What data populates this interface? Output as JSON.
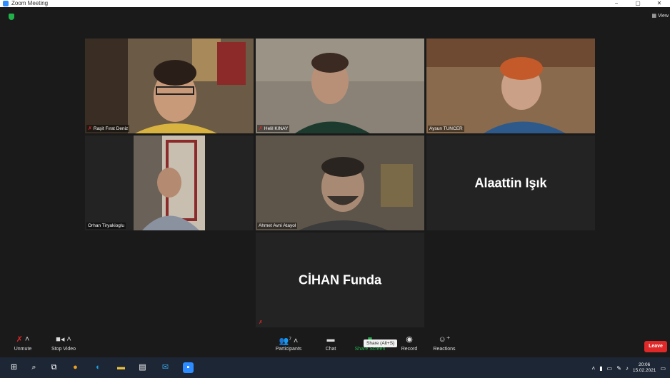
{
  "window": {
    "title": "Zoom Meeting",
    "minimize": "−",
    "maximize": "▢",
    "close": "✕"
  },
  "view_label": "View",
  "participants_tiles": [
    {
      "name": "Raşit Fırat Deniz",
      "muted": true
    },
    {
      "name": "Helil KINAY",
      "muted": true
    },
    {
      "name": "Aysun TUNCER",
      "muted": false
    },
    {
      "name": "Orhan Tiryakioglu",
      "muted": false
    },
    {
      "name": "Ahmet Avni Atayol",
      "muted": false
    },
    {
      "name": "Alaattin Işık",
      "muted": false,
      "video_off": true
    },
    {
      "name": "CİHAN Funda",
      "muted": true,
      "video_off": true
    }
  ],
  "toolbar": {
    "unmute": "Unmute",
    "stop_video": "Stop Video",
    "participants": "Participants",
    "participants_count": "7",
    "chat": "Chat",
    "share_screen": "Share Screen",
    "record": "Record",
    "reactions": "Reactions",
    "share_tooltip": "Share (Alt+S)",
    "leave": "Leave"
  },
  "taskbar": {
    "time": "20:06",
    "date": "15.02.2021"
  },
  "colors": {
    "accent_green": "#21b14b",
    "leave_red": "#e02828",
    "active_speaker": "#c8e04a",
    "zoom_blue": "#2d8cff"
  }
}
